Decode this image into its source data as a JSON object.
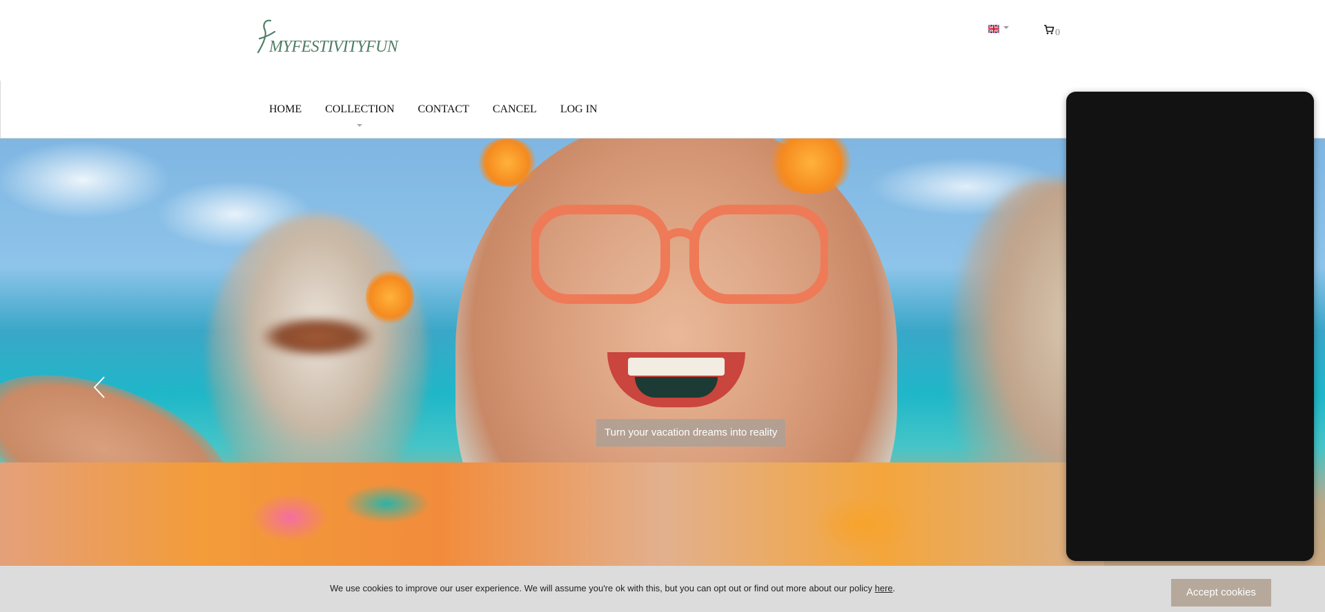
{
  "header": {
    "logo_text": "MYFESTIVITYFUN",
    "language": {
      "flag_icon": "uk-flag-icon",
      "selected": "English"
    },
    "cart": {
      "icon": "cart-icon",
      "count": "0"
    }
  },
  "nav": {
    "items": [
      {
        "label": "HOME"
      },
      {
        "label": "COLLECTION",
        "has_submenu": true
      },
      {
        "label": "CONTACT"
      },
      {
        "label": "CANCEL"
      },
      {
        "label": "LOG IN"
      }
    ]
  },
  "hero": {
    "caption": "Turn your vacation dreams into reality",
    "prev_icon": "chevron-left-icon"
  },
  "cookie_bar": {
    "message": "We use cookies to improve our user experience. We will assume you're ok with this, but you can opt out or find out more about our policy ",
    "link_text": "here",
    "message_end": ".",
    "accept_label": "Accept cookies"
  },
  "colors": {
    "logo": "#4f7d63",
    "panel": "#121212",
    "cookie_bg": "#dcdcdc",
    "accept_button": "#b6a99b",
    "caption_bg": "#aaa096"
  }
}
